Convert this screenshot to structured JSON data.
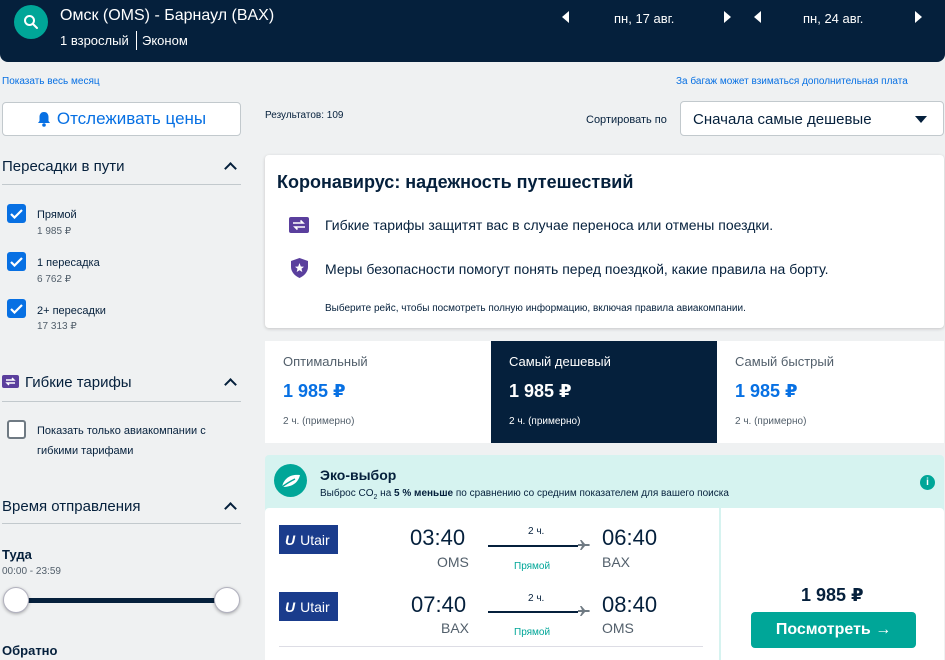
{
  "header": {
    "route": "Омск (OMS) - Барнаул (BAX)",
    "passengers": "1 взрослый",
    "cabin": "Эконом",
    "depart_date": "пн, 17 авг.",
    "return_date": "пн, 24 авг."
  },
  "links": {
    "show_month": "Показать весь месяц",
    "baggage_fee": "За багаж может взиматься дополнительная плата"
  },
  "sidebar": {
    "track_prices": "Отслеживать цены",
    "stops_title": "Пересадки в пути",
    "stops": [
      {
        "label": "Прямой",
        "price": "1 985 ₽",
        "checked": true
      },
      {
        "label": "1 пересадка",
        "price": "6 762 ₽",
        "checked": true
      },
      {
        "label": "2+ пересадки",
        "price": "17 313 ₽",
        "checked": true
      }
    ],
    "flex_title": "Гибкие тарифы",
    "flex_option_line1": "Показать только авиакомпании с",
    "flex_option_line2": "гибкими тарифами",
    "time_title": "Время отправления",
    "outbound_label": "Туда",
    "outbound_range": "00:00 - 23:59",
    "return_label": "Обратно"
  },
  "results": {
    "count": "Результатов: 109",
    "sort_label": "Сортировать по",
    "sort_value": "Сначала самые дешевые"
  },
  "covid": {
    "title": "Коронавирус: надежность путешествий",
    "line1": "Гибкие тарифы защитят вас в случае переноса или отмены поездки.",
    "line2": "Меры безопасности помогут понять перед поездкой, какие правила на борту.",
    "note": "Выберите рейс, чтобы посмотреть полную информацию, включая правила авиакомпании."
  },
  "tabs": [
    {
      "name": "Оптимальный",
      "price": "1 985 ₽",
      "duration": "2 ч. (примерно)",
      "active": false
    },
    {
      "name": "Самый дешевый",
      "price": "1 985 ₽",
      "duration": "2 ч. (примерно)",
      "active": true
    },
    {
      "name": "Самый быстрый",
      "price": "1 985 ₽",
      "duration": "2 ч. (примерно)",
      "active": false
    }
  ],
  "eco": {
    "title": "Эко-выбор",
    "desc_pre": "Выброс CO",
    "desc_sub": "2",
    "desc_mid": " на ",
    "desc_bold": "5 % меньше",
    "desc_post": " по сравнению со средним показателем для вашего поиска",
    "info": "i"
  },
  "flights": [
    {
      "airline": "Utair",
      "dep_time": "03:40",
      "dep_apt": "OMS",
      "arr_time": "06:40",
      "arr_apt": "BAX",
      "duration": "2 ч.",
      "stops": "Прямой"
    },
    {
      "airline": "Utair",
      "dep_time": "07:40",
      "dep_apt": "BAX",
      "arr_time": "08:40",
      "arr_apt": "OMS",
      "duration": "2 ч.",
      "stops": "Прямой"
    }
  ],
  "offer": {
    "price": "1 985 ₽",
    "view_label": "Посмотреть →"
  },
  "colors": {
    "navy": "#05203c",
    "blue": "#0770e3",
    "teal": "#00a698",
    "eco_bg": "#d6f3f0"
  }
}
